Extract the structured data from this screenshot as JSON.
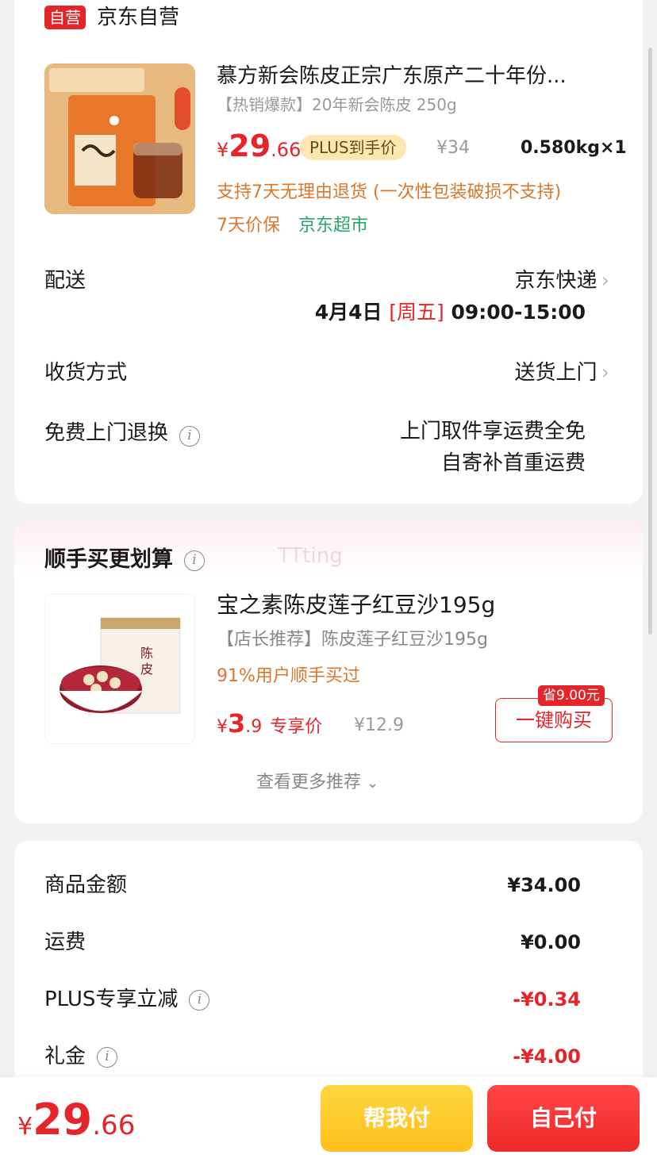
{
  "store": {
    "badge": "自营",
    "name": "京东自营"
  },
  "product": {
    "image_icon": "chenpi-product-image",
    "title": "慕方新会陈皮正宗广东原产二十年份...",
    "spec": "【热销爆款】20年新会陈皮 250g",
    "price_symbol": "¥",
    "price_int": "29",
    "price_dec": ".66",
    "plus_tag": "PLUS到手价",
    "original_price": "¥34",
    "weight_qty": "0.580kg×1",
    "service_line1": "支持7天无理由退货 (一次性包装破损不支持)",
    "service_price_protect": "7天价保",
    "service_supermarket": "京东超市"
  },
  "delivery": {
    "label": "配送",
    "carrier": "京东快递",
    "date": "4月4日",
    "weekday": "[周五]",
    "time": "09:00-15:00"
  },
  "receive": {
    "label": "收货方式",
    "value": "送货上门"
  },
  "free_return": {
    "label": "免费上门退换",
    "line1": "上门取件享运费全免",
    "line2": "自寄补首重运费"
  },
  "recommend": {
    "section_title": "顺手买更划算",
    "watermark": "TTting",
    "image_icon": "red-bean-paste-product-image",
    "title": "宝之素陈皮莲子红豆沙195g",
    "spec": "【店长推荐】陈皮莲子红豆沙195g",
    "stat": "91%用户顺手买过",
    "price_symbol": "¥",
    "price_int": "3",
    "price_dec": ".9",
    "price_label": "专享价",
    "original_price": "¥12.9",
    "save_tag": "省9.00元",
    "buy_button": "一键购买",
    "more_link": "查看更多推荐"
  },
  "summary": {
    "items": [
      {
        "label": "商品金额",
        "value": "¥34.00",
        "info": false,
        "negative": false
      },
      {
        "label": "运费",
        "value": "¥0.00",
        "info": false,
        "negative": false
      },
      {
        "label": "PLUS专享立减",
        "value": "-¥0.34",
        "info": true,
        "negative": true
      },
      {
        "label": "礼金",
        "value": "-¥4.00",
        "info": true,
        "negative": true
      }
    ]
  },
  "bottom": {
    "price_symbol": "¥",
    "price_int": "29",
    "price_dec": ".66",
    "help_pay": "帮我付",
    "self_pay": "自己付"
  },
  "colors": {
    "accent_red": "#e4262b",
    "orange_text": "#d9772c",
    "green_text": "#2aa56b",
    "plus_gold": "#fbe7b1",
    "help_button_yellow": "#ffc62a"
  }
}
